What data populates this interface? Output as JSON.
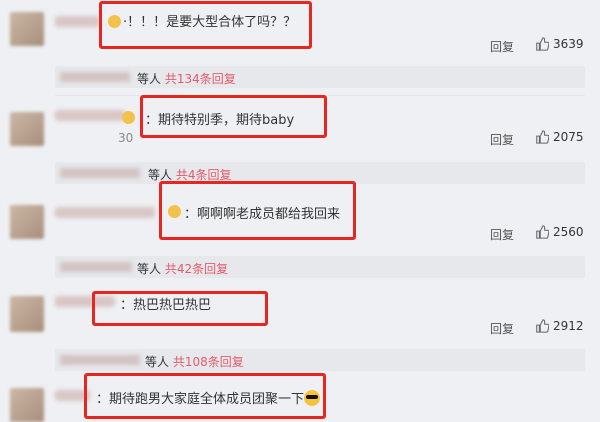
{
  "comments": [
    {
      "text": "·！！！是要大型合体了吗？？",
      "reply_label": "回复",
      "likes": "3639"
    },
    {
      "text": "：期待特别季，期待baby",
      "reply_label": "回复",
      "likes": "2075",
      "faint": "30"
    },
    {
      "text": "：啊啊啊老成员都给我回来",
      "reply_label": "回复",
      "likes": "2560"
    },
    {
      "text": "：热巴热巴热巴",
      "reply_label": "回复",
      "likes": "2912"
    },
    {
      "text": "：期待跑男大家庭全体成员团聚一下"
    }
  ],
  "subreplies": [
    {
      "prefix": "等人",
      "count": "共134条回复"
    },
    {
      "prefix": "等人",
      "count": "共4条回复"
    },
    {
      "prefix": "等人",
      "count": "共42条回复"
    },
    {
      "prefix": "等人",
      "count": "共108条回复"
    }
  ],
  "colors": {
    "highlight": "#e8251e",
    "reply_count": "#e45b6c",
    "background": "#eef0f3"
  },
  "icons": [
    "thumbs-up-icon",
    "emoji-icon",
    "sunglasses-emoji-icon"
  ]
}
